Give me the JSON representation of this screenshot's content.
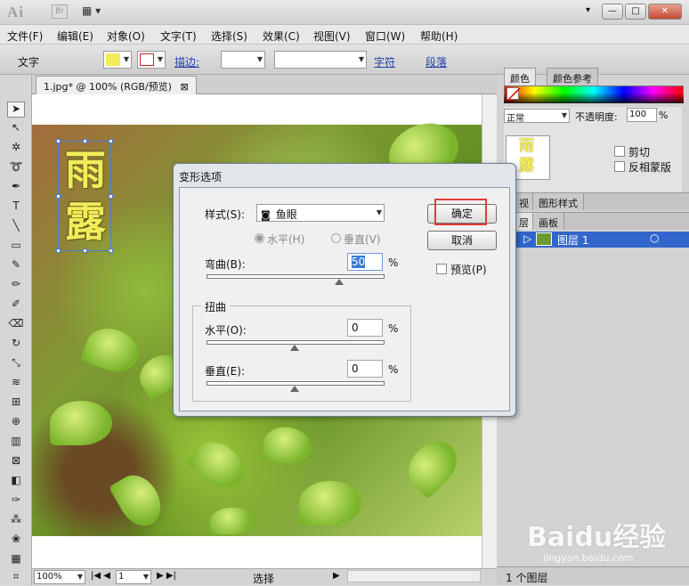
{
  "app": {
    "logo": "Ai",
    "bridge": "Br",
    "arrange_icon": "▦ ▾",
    "win_min": "▾",
    "win_btns": [
      "—",
      "□",
      "✕"
    ]
  },
  "menus": [
    "文件(F)",
    "编辑(E)",
    "对象(O)",
    "文字(T)",
    "选择(S)",
    "效果(C)",
    "视图(V)",
    "窗口(W)",
    "帮助(H)"
  ],
  "control": {
    "tool_name": "文字",
    "stroke_label": "描边:",
    "char_link": "字符",
    "para_link": "段落"
  },
  "document": {
    "tab": "1.jpg* @ 100% (RGB/预览)",
    "close": "⊠",
    "chars": [
      "雨",
      "露"
    ]
  },
  "statusbar": {
    "zoom": "100%",
    "page": "1",
    "status": "选择"
  },
  "panels": {
    "color_tab": "颜色",
    "color_ref_tab": "颜色参考",
    "blend_mode": "正常",
    "opacity_label": "不透明度:",
    "opacity_value": "100",
    "opacity_unit": "%",
    "thumb_chars": [
      "雨",
      "露"
    ],
    "clip_label": "剪切",
    "invert_mask": "反相蒙版",
    "view_tab": "视",
    "graphic_style_tab": "图形样式",
    "layer_tab": "层",
    "artboard_tab": "画板",
    "layer_name": "图层 1",
    "layer_count": "1 个图层"
  },
  "dialog": {
    "title": "变形选项",
    "style_label": "样式(S):",
    "style_value": "鱼眼",
    "horizontal": "水平(H)",
    "vertical": "垂直(V)",
    "bend_label": "弯曲(B):",
    "bend_value": "50",
    "pct": "%",
    "distort_title": "扭曲",
    "h_label": "水平(O):",
    "h_value": "0",
    "v_label": "垂直(E):",
    "v_value": "0",
    "ok": "确定",
    "cancel": "取消",
    "preview": "预览(P)"
  },
  "watermark": {
    "logo": "Baidu经验",
    "url": "jingyan.baidu.com"
  },
  "colors": {
    "highlight": "#e23b3b",
    "layer_selected": "#3366cc",
    "text_yellow": "#f2ec5a"
  }
}
